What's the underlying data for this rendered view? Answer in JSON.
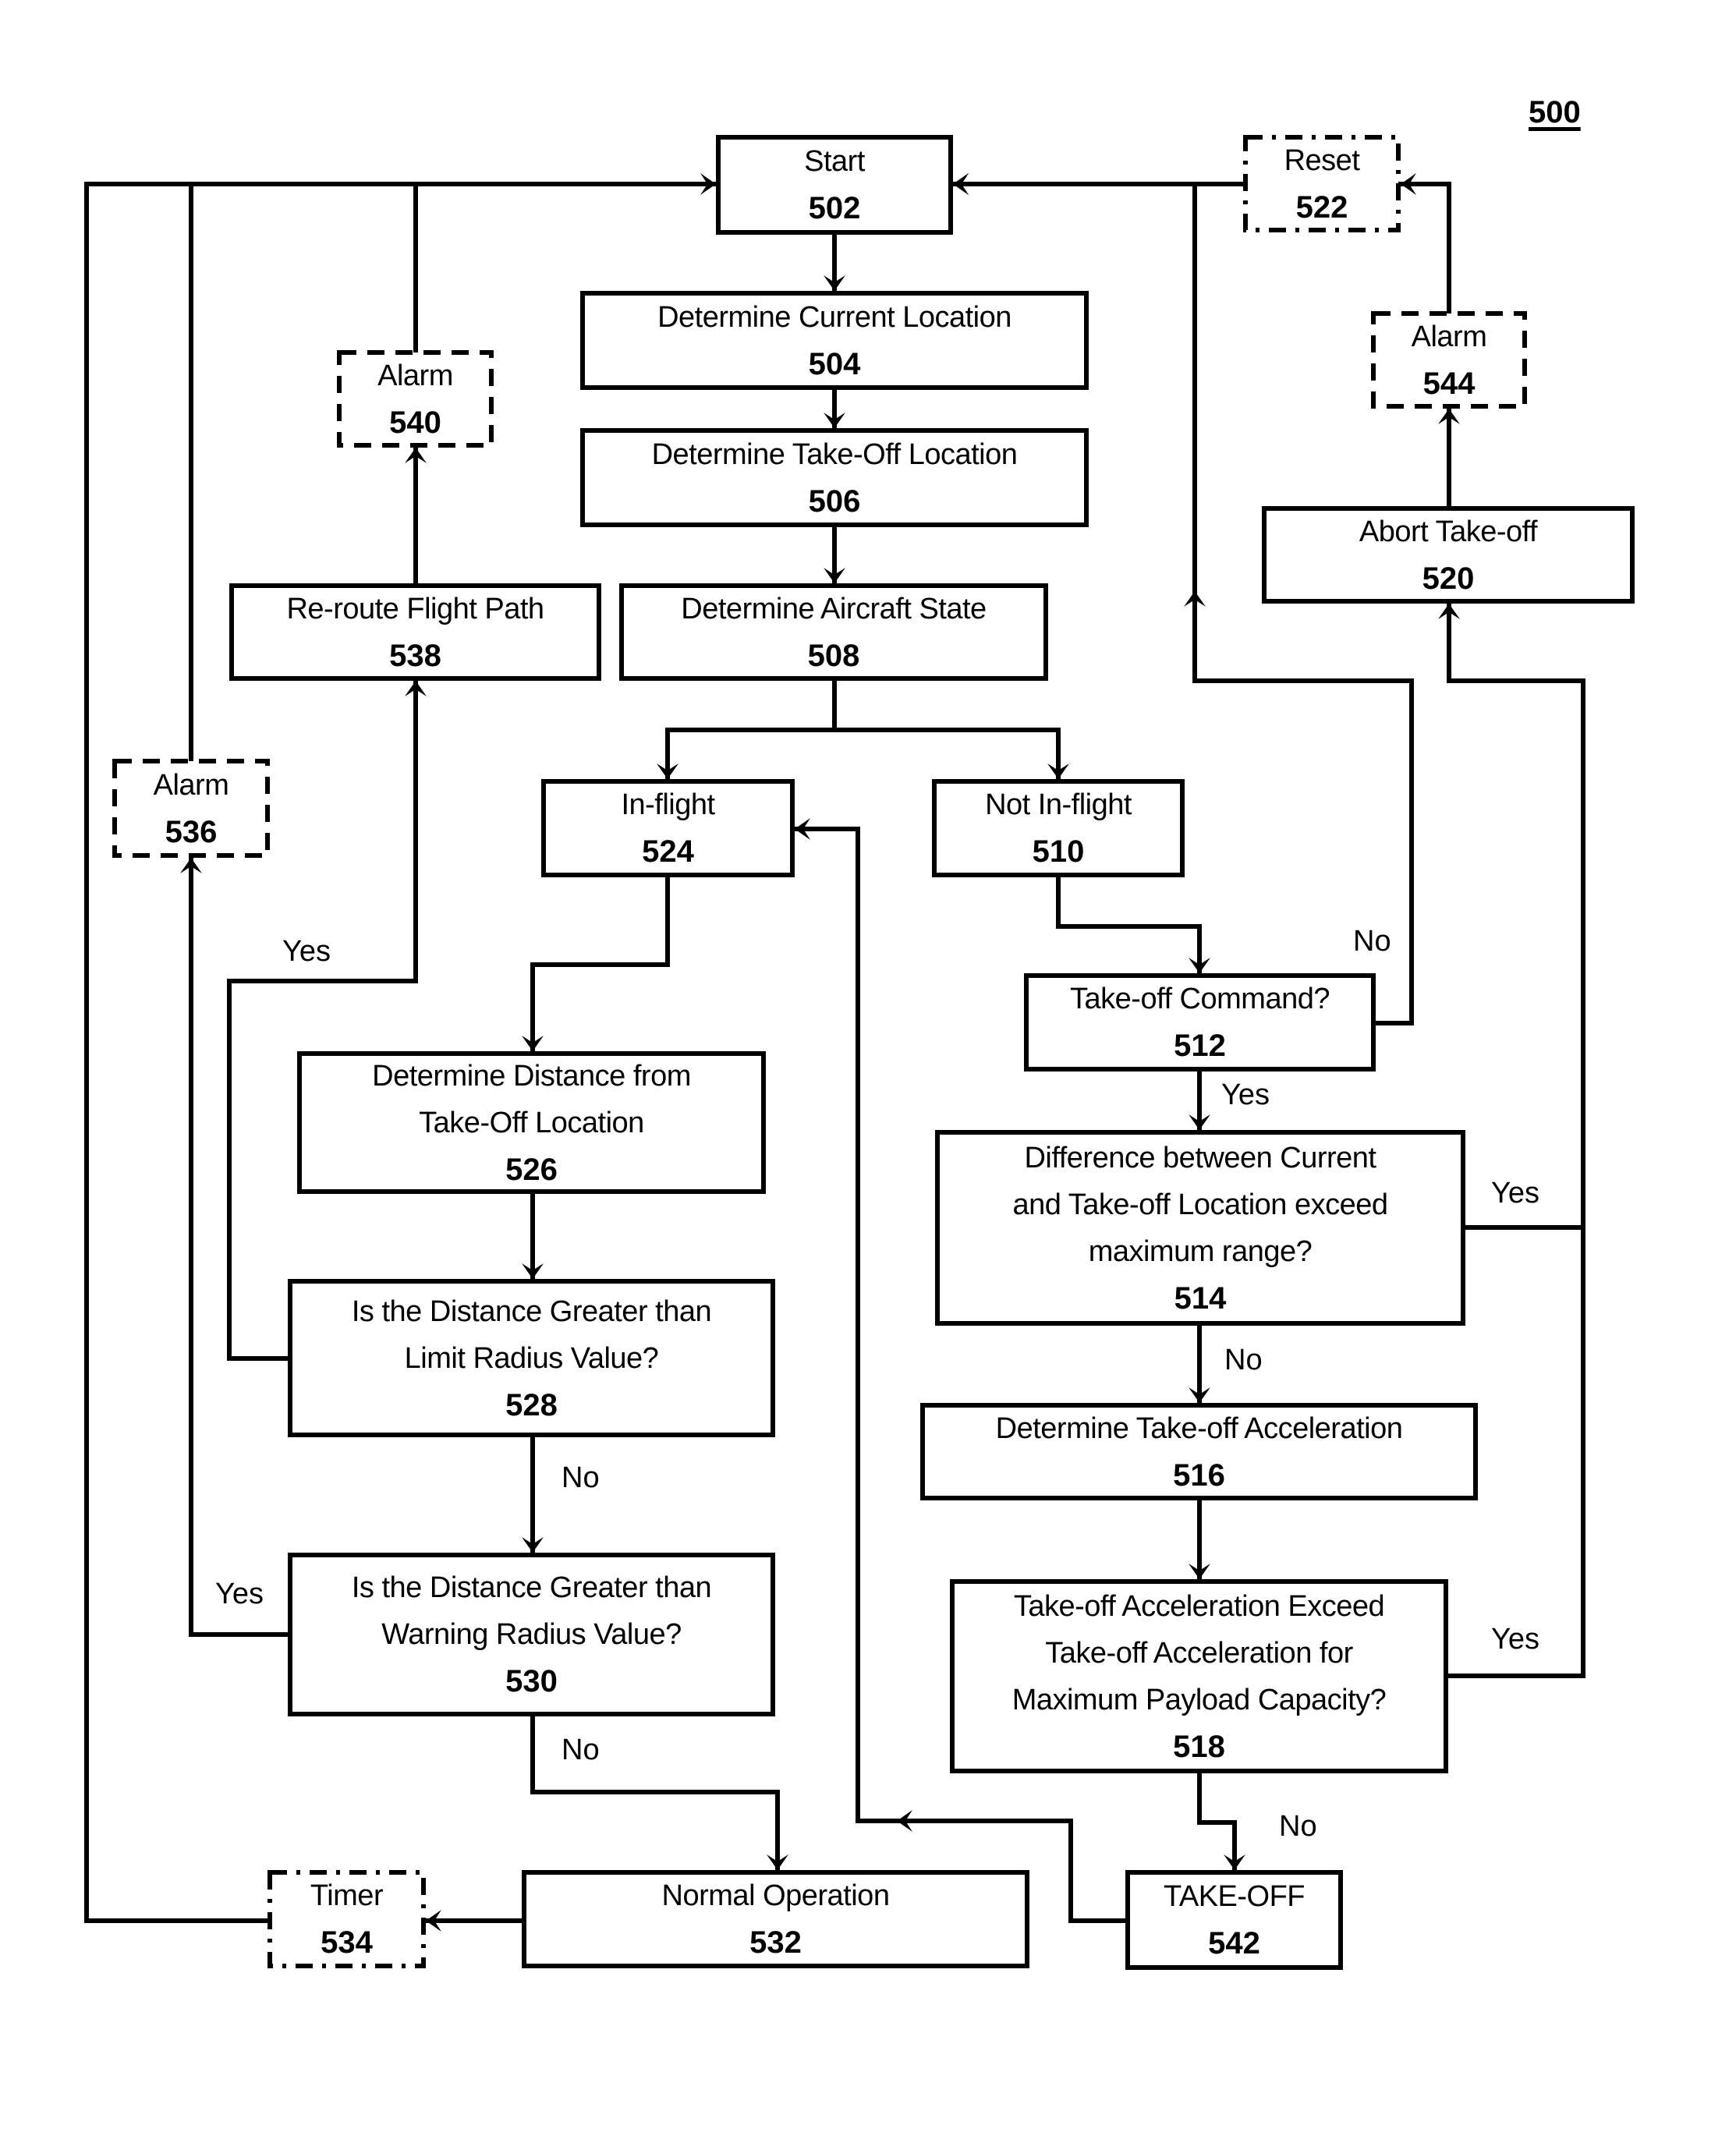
{
  "figure": {
    "label": "500",
    "type": "flowchart"
  },
  "nodes": [
    {
      "id": "502",
      "text": "Start",
      "ref": "502",
      "border": "solid"
    },
    {
      "id": "504",
      "text": "Determine  Current Location",
      "ref": "504",
      "border": "solid"
    },
    {
      "id": "506",
      "text": "Determine Take-Off Location",
      "ref": "506",
      "border": "solid"
    },
    {
      "id": "508",
      "text": "Determine Aircraft State",
      "ref": "508",
      "border": "solid"
    },
    {
      "id": "510",
      "text": "Not In-flight",
      "ref": "510",
      "border": "solid"
    },
    {
      "id": "512",
      "text": "Take-off Command?",
      "ref": "512",
      "border": "solid"
    },
    {
      "id": "514",
      "text": "Difference between Current\nand Take-off Location exceed\nmaximum range?",
      "ref": "514",
      "border": "solid"
    },
    {
      "id": "516",
      "text": "Determine Take-off Acceleration",
      "ref": "516",
      "border": "solid"
    },
    {
      "id": "518",
      "text": "Take-off Acceleration Exceed\nTake-off Acceleration for\nMaximum Payload Capacity?",
      "ref": "518",
      "border": "solid"
    },
    {
      "id": "520",
      "text": "Abort Take-off",
      "ref": "520",
      "border": "solid"
    },
    {
      "id": "522",
      "text": "Reset",
      "ref": "522",
      "border": "dash-dot"
    },
    {
      "id": "524",
      "text": "In-flight",
      "ref": "524",
      "border": "solid"
    },
    {
      "id": "526",
      "text": "Determine Distance from\nTake-Off Location",
      "ref": "526",
      "border": "solid"
    },
    {
      "id": "528",
      "text": "Is the Distance Greater than\nLimit Radius Value?",
      "ref": "528",
      "border": "solid"
    },
    {
      "id": "530",
      "text": "Is the Distance Greater than\nWarning Radius Value?",
      "ref": "530",
      "border": "solid"
    },
    {
      "id": "532",
      "text": "Normal Operation",
      "ref": "532",
      "border": "solid"
    },
    {
      "id": "534",
      "text": "Timer",
      "ref": "534",
      "border": "dash-dot"
    },
    {
      "id": "536",
      "text": "Alarm",
      "ref": "536",
      "border": "dashed"
    },
    {
      "id": "538",
      "text": "Re-route Flight Path",
      "ref": "538",
      "border": "solid"
    },
    {
      "id": "540",
      "text": "Alarm",
      "ref": "540",
      "border": "dashed"
    },
    {
      "id": "542",
      "text": "TAKE-OFF",
      "ref": "542",
      "border": "solid"
    },
    {
      "id": "544",
      "text": "Alarm",
      "ref": "544",
      "border": "dashed"
    }
  ],
  "edges": [
    {
      "id": "e1",
      "from": "502",
      "to": "504",
      "label": ""
    },
    {
      "id": "e2",
      "from": "504",
      "to": "506",
      "label": ""
    },
    {
      "id": "e3",
      "from": "506",
      "to": "508",
      "label": ""
    },
    {
      "id": "e4",
      "from": "508",
      "to": "524",
      "label": ""
    },
    {
      "id": "e5",
      "from": "508",
      "to": "510",
      "label": ""
    },
    {
      "id": "e6",
      "from": "524",
      "to": "526",
      "label": ""
    },
    {
      "id": "e7",
      "from": "510",
      "to": "512",
      "label": ""
    },
    {
      "id": "e8",
      "from": "512",
      "to": "502",
      "label": "No"
    },
    {
      "id": "e9",
      "from": "522",
      "to": "502",
      "label": ""
    },
    {
      "id": "e10",
      "from": "544",
      "to": "522",
      "label": ""
    },
    {
      "id": "e11",
      "from": "520",
      "to": "544",
      "label": ""
    },
    {
      "id": "e12",
      "from": "514",
      "to": "520",
      "label": "Yes"
    },
    {
      "id": "e13",
      "from": "518",
      "to": "520",
      "label": "Yes"
    },
    {
      "id": "e14",
      "from": "512",
      "to": "514",
      "label": "Yes"
    },
    {
      "id": "e15",
      "from": "514",
      "to": "516",
      "label": "No"
    },
    {
      "id": "e16",
      "from": "516",
      "to": "518",
      "label": ""
    },
    {
      "id": "e17",
      "from": "518",
      "to": "542",
      "label": "No"
    },
    {
      "id": "e18",
      "from": "542",
      "to": "524",
      "label": ""
    },
    {
      "id": "e19",
      "from": "526",
      "to": "528",
      "label": ""
    },
    {
      "id": "e20",
      "from": "528",
      "to": "530",
      "label": "No"
    },
    {
      "id": "e21",
      "from": "528",
      "to": "538",
      "label": "Yes"
    },
    {
      "id": "e22",
      "from": "538",
      "to": "540",
      "label": ""
    },
    {
      "id": "e23",
      "from": "540",
      "to": "502",
      "label": ""
    },
    {
      "id": "e24",
      "from": "530",
      "to": "536",
      "label": "Yes"
    },
    {
      "id": "e25",
      "from": "536",
      "to": "502",
      "label": ""
    },
    {
      "id": "e26",
      "from": "530",
      "to": "532",
      "label": "No"
    },
    {
      "id": "e27",
      "from": "532",
      "to": "534",
      "label": ""
    },
    {
      "id": "e28",
      "from": "534",
      "to": "502",
      "label": ""
    }
  ],
  "edge_labels": {
    "yes": "Yes",
    "no": "No"
  }
}
